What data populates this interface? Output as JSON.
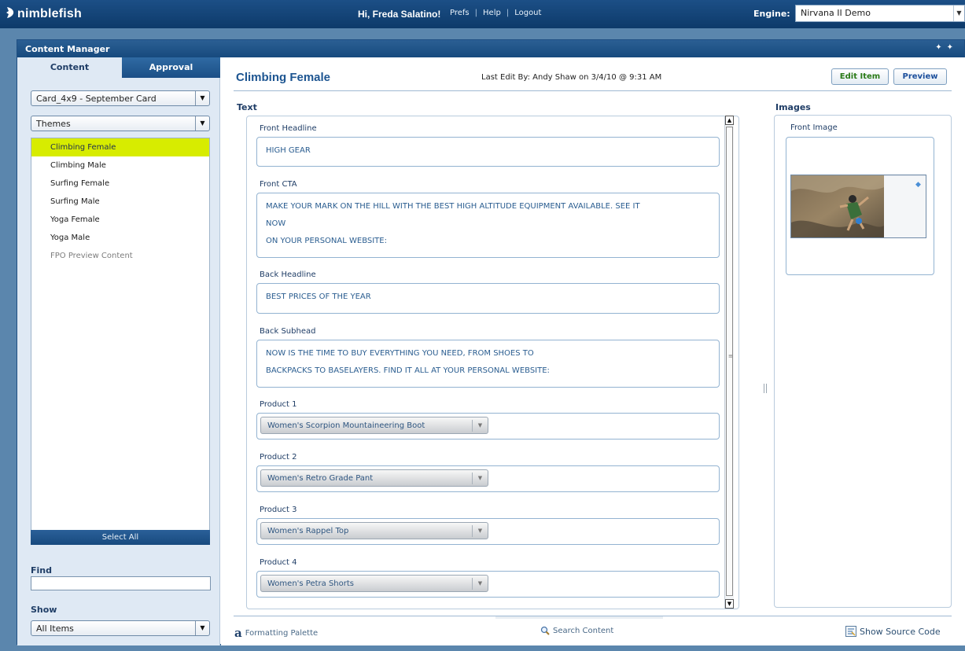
{
  "header": {
    "logo": "nimblefish",
    "greeting": "Hi, Freda Salatino!",
    "links": [
      "Prefs",
      "Help",
      "Logout"
    ],
    "engine_label": "Engine:",
    "engine_value": "Nirvana II Demo"
  },
  "window": {
    "title": "Content Manager"
  },
  "sidebar": {
    "tabs": [
      "Content",
      "Approval"
    ],
    "card_select": "Card_4x9 - September Card",
    "themes_select": "Themes",
    "items": [
      {
        "label": "Climbing Female"
      },
      {
        "label": "Climbing Male"
      },
      {
        "label": "Surfing Female"
      },
      {
        "label": "Surfing Male"
      },
      {
        "label": "Yoga Female"
      },
      {
        "label": "Yoga Male"
      },
      {
        "label": "FPO Preview Content"
      }
    ],
    "select_all": "Select All",
    "find_label": "Find",
    "find_value": "",
    "show_label": "Show",
    "show_select": "All Items"
  },
  "main": {
    "title": "Climbing Female",
    "last_edit": "Last Edit By: Andy Shaw on 3/4/10 @ 9:31 AM",
    "edit_button": "Edit Item",
    "preview_button": "Preview",
    "text_heading": "Text",
    "images_heading": "Images",
    "fields": {
      "front_headline": {
        "label": "Front Headline",
        "lines": [
          "HIGH GEAR"
        ]
      },
      "front_cta": {
        "label": "Front CTA",
        "lines": [
          "MAKE YOUR MARK ON THE HILL WITH THE BEST HIGH ALTITUDE EQUIPMENT AVAILABLE. SEE IT",
          "NOW",
          "ON YOUR PERSONAL WEBSITE:"
        ]
      },
      "back_headline": {
        "label": "Back Headline",
        "lines": [
          "BEST PRICES OF THE YEAR"
        ]
      },
      "back_subhead": {
        "label": "Back Subhead",
        "lines": [
          "NOW IS THE TIME TO BUY EVERYTHING YOU NEED, FROM SHOES TO",
          "BACKPACKS TO BASELAYERS. FIND IT ALL AT YOUR PERSONAL WEBSITE:"
        ]
      }
    },
    "products": [
      {
        "label": "Product 1",
        "value": "Women's Scorpion Mountaineering Boot"
      },
      {
        "label": "Product 2",
        "value": "Women's Retro Grade Pant"
      },
      {
        "label": "Product 3",
        "value": "Women's Rappel Top"
      },
      {
        "label": "Product 4",
        "value": "Women's Petra Shorts"
      }
    ],
    "front_image_label": "Front Image"
  },
  "footer": {
    "formatting_palette": "Formatting Palette",
    "search_content": "Search Content",
    "show_source": "Show Source Code"
  },
  "colors": {
    "selected_item": "#d7ec00",
    "accent_blue": "#1d5591",
    "header_bg": "#0d3a6a"
  }
}
